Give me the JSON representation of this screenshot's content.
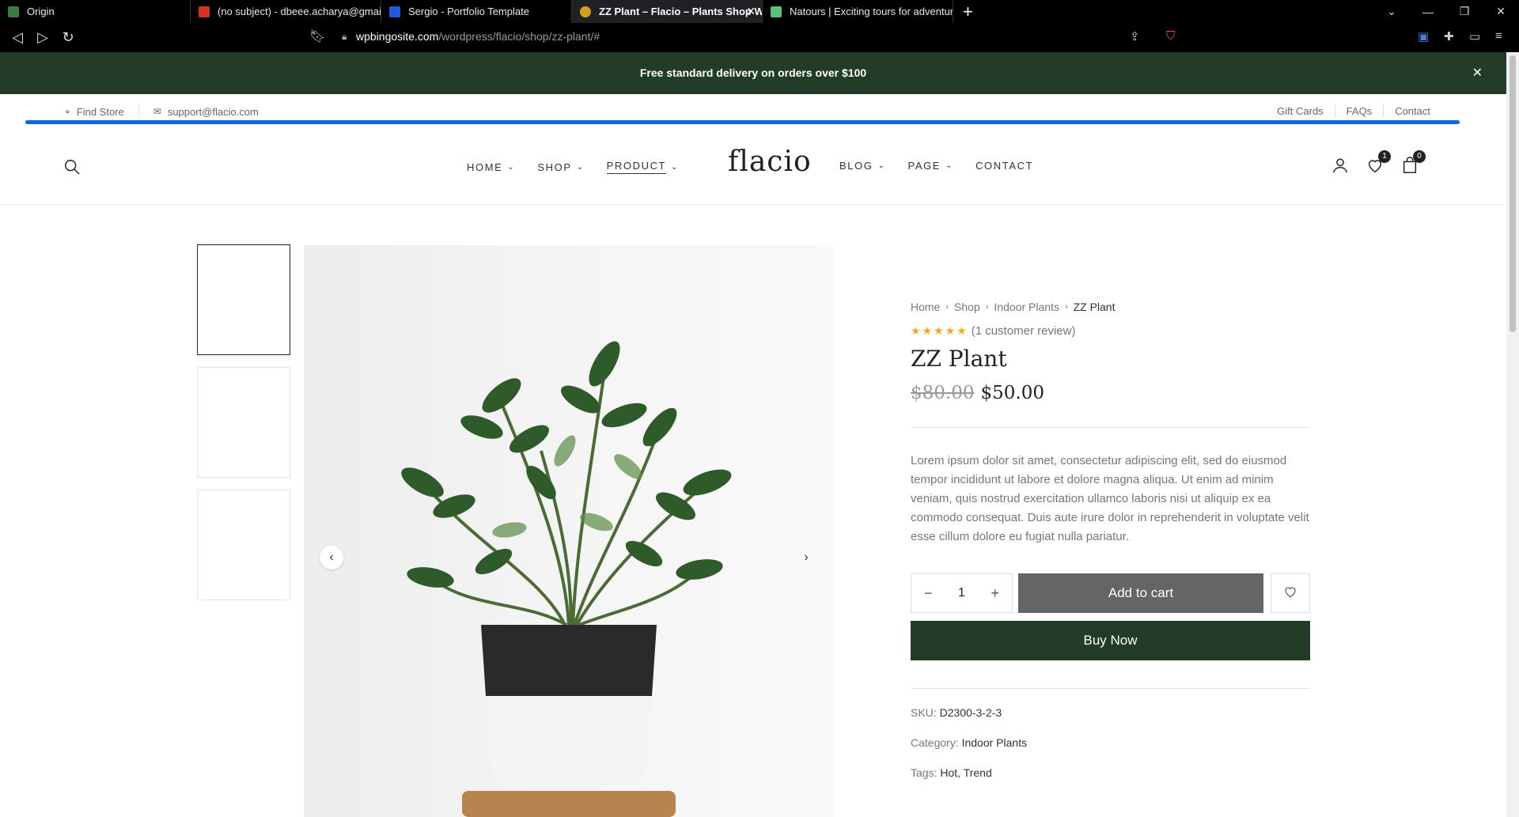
{
  "browser": {
    "tabs": [
      {
        "title": "Origin",
        "color": "#3a7d44"
      },
      {
        "title": "(no subject) - dbeee.acharya@gmail.c",
        "color": "#d93025"
      },
      {
        "title": "Sergio - Portfolio Template",
        "color": "#1e5bd8"
      },
      {
        "title": "ZZ Plant – Flacio – Plants Shop W",
        "color": "#d4a017"
      },
      {
        "title": "Natours | Exciting tours for adventuro",
        "color": "#55c57a"
      }
    ],
    "url_domain": "wpbingosite.com",
    "url_path": "/wordpress/flacio/shop/zz-plant/#"
  },
  "promo": {
    "text": "Free standard delivery on orders over $100"
  },
  "topbar": {
    "find_store": "Find Store",
    "email": "support@flacio.com",
    "links": [
      "Gift Cards",
      "FAQs",
      "Contact"
    ]
  },
  "header": {
    "logo": "flacio",
    "nav_left": [
      {
        "label": "HOME",
        "dropdown": true
      },
      {
        "label": "SHOP",
        "dropdown": true
      },
      {
        "label": "PRODUCT",
        "dropdown": true
      }
    ],
    "nav_right": [
      {
        "label": "BLOG",
        "dropdown": true
      },
      {
        "label": "PAGE",
        "dropdown": true
      },
      {
        "label": "CONTACT",
        "dropdown": false
      }
    ],
    "wishlist_count": "1",
    "cart_count": "0"
  },
  "product": {
    "breadcrumb": [
      "Home",
      "Shop",
      "Indoor Plants",
      "ZZ Plant"
    ],
    "rating": 5,
    "review_text": "(1 customer review)",
    "title": "ZZ Plant",
    "old_price": "$80.00",
    "price": "$50.00",
    "description": "Lorem ipsum dolor sit amet, consectetur adipiscing elit, sed do eiusmod tempor incididunt ut labore et dolore magna aliqua. Ut enim ad minim veniam, quis nostrud exercitation ullamco laboris nisi ut aliquip ex ea commodo consequat. Duis aute irure dolor in reprehenderit in voluptate velit esse cillum dolore eu fugiat nulla pariatur.",
    "quantity": "1",
    "add_to_cart": "Add to cart",
    "buy_now": "Buy Now",
    "sku_label": "SKU:",
    "sku": "D2300-3-2-3",
    "category_label": "Category:",
    "category": "Indoor Plants",
    "tags_label": "Tags:",
    "tags": "Hot, Trend"
  },
  "colors": {
    "brand_green": "#233c27",
    "add_to_cart_gray": "#656565",
    "star": "#f5a623"
  }
}
